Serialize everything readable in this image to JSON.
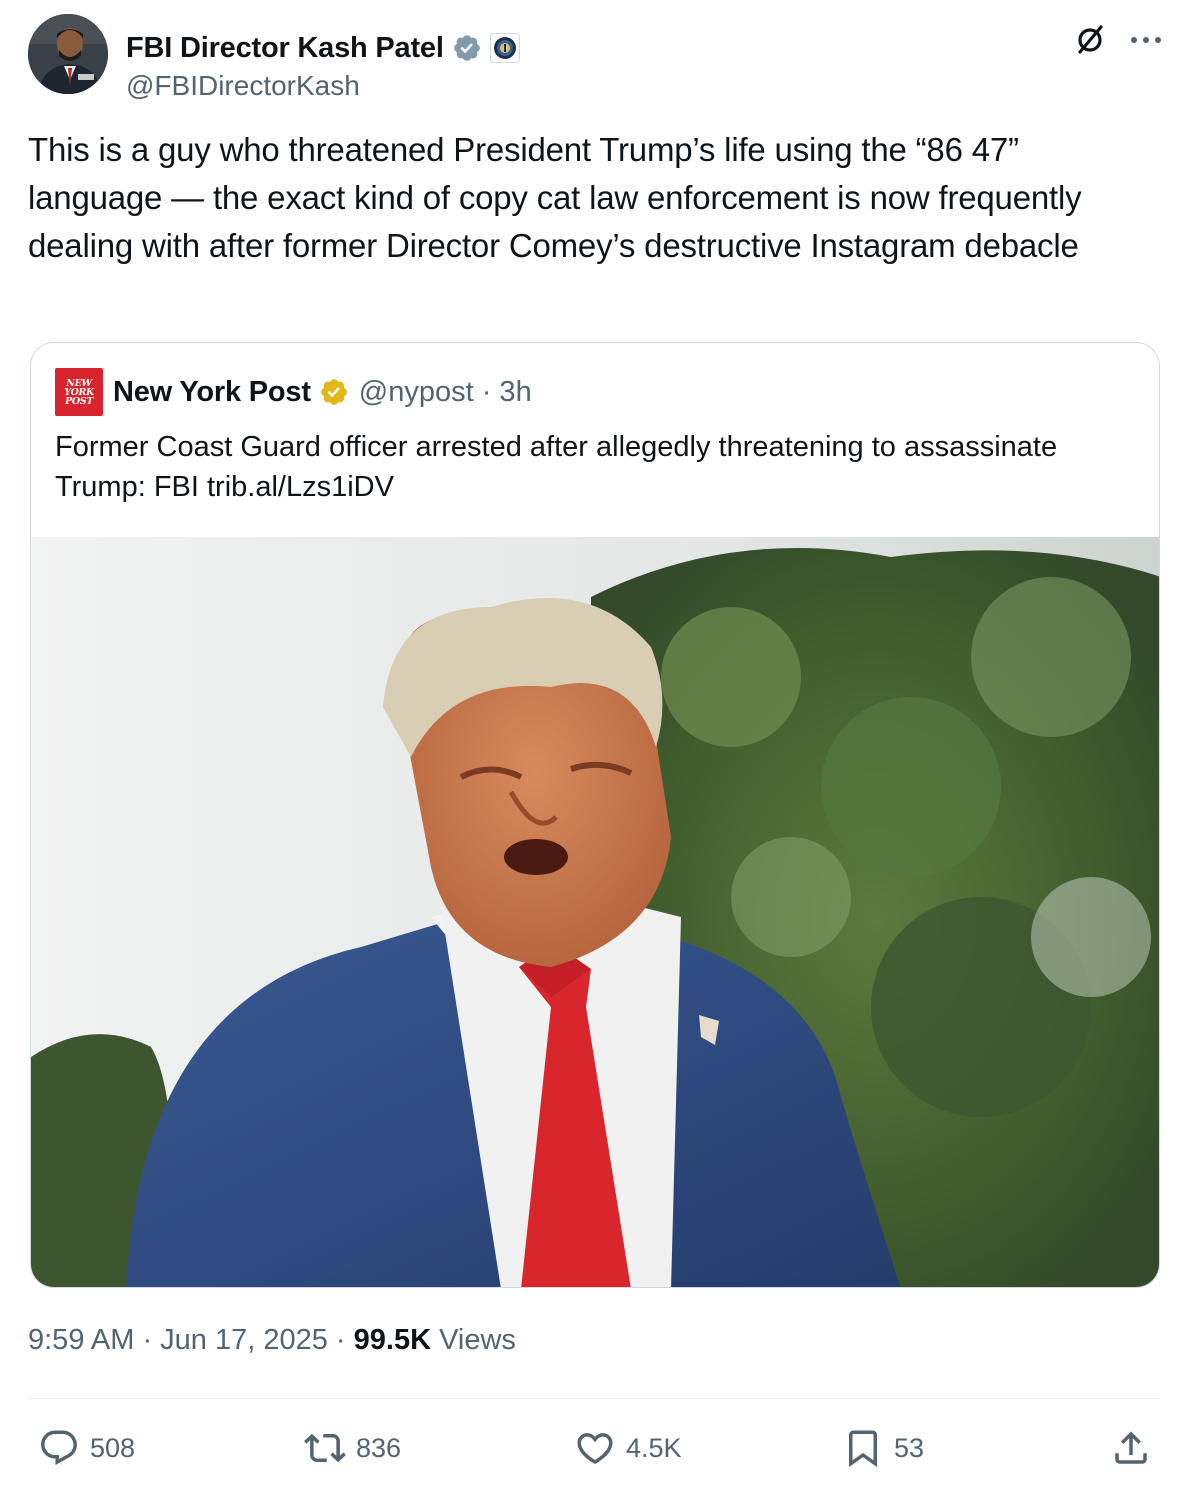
{
  "author": {
    "display_name": "FBI Director Kash Patel",
    "handle": "@FBIDirectorKash",
    "avatar_icon": "profile-photo",
    "verified_icon": "verified-badge-blue",
    "affiliation_icon": "fbi-seal-badge"
  },
  "tweet": {
    "text": "This is a guy who threatened President Trump’s life using the “86 47” language — the exact kind of copy cat law enforcement is now frequently dealing with after former Director Comey’s destructive Instagram debacle"
  },
  "quote": {
    "logo_lines": [
      "NEW",
      "YORK",
      "POST"
    ],
    "display_name": "New York Post",
    "verified_icon": "verified-badge-gold",
    "handle_time": "@nypost · 3h",
    "text": "Former Coast Guard officer arrested after allegedly threatening to assassinate Trump: FBI trib.al/Lzs1iDV",
    "image_icon": "photo-man-in-suit-outdoors"
  },
  "meta": {
    "time_date": "9:59 AM · Jun 17, 2025 · ",
    "views_count": "99.5K",
    "views_label": " Views"
  },
  "actions": {
    "replies": "508",
    "reposts": "836",
    "likes": "4.5K",
    "bookmarks": "53"
  },
  "colors": {
    "text": "#0f1419",
    "secondary": "#536471",
    "border": "#cfd9de",
    "verified_blue": "#829aab",
    "verified_gold": "#e2b719",
    "nyp_red": "#d7242d"
  }
}
